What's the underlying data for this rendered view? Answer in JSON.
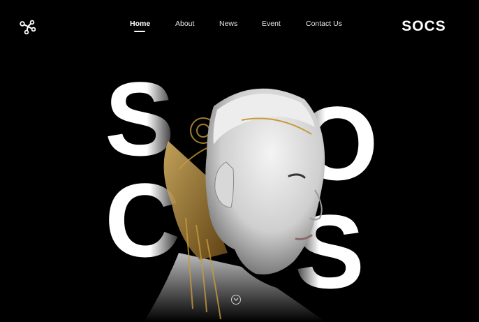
{
  "nav": {
    "items": [
      {
        "label": "Home",
        "active": true
      },
      {
        "label": "About",
        "active": false
      },
      {
        "label": "News",
        "active": false
      },
      {
        "label": "Event",
        "active": false
      },
      {
        "label": "Contact Us",
        "active": false
      }
    ]
  },
  "brand": {
    "text": "SOCS"
  },
  "hero": {
    "letters": [
      "S",
      "O",
      "C",
      "S"
    ],
    "scroll_icon": "chevron-down-icon"
  },
  "colors": {
    "background": "#000000",
    "text": "#ffffff",
    "accent": "#c89a3a"
  }
}
